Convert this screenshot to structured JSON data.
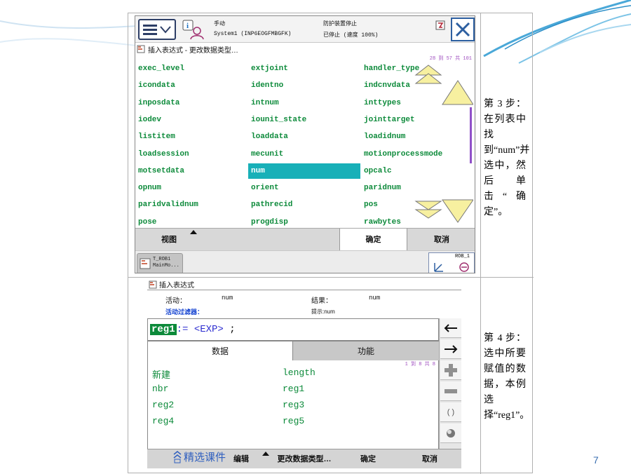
{
  "colors": {
    "list_text": "#0c8a3a",
    "selection": "#18b0b8",
    "accent_purple": "#9050c8",
    "deco_blue": "#4aa8d8"
  },
  "screen1": {
    "status": {
      "mode": "手动",
      "system": "System1 (INP6EOGFMBGFK)",
      "safety": "防护装置停止",
      "state": "已停止 (速度 100%)"
    },
    "title": "插入表达式 - 更改数据类型…",
    "counter": "28 到 57 共 101",
    "items": [
      [
        "exec_level",
        "extjoint",
        "handler_type"
      ],
      [
        "icondata",
        "identno",
        "indcnvdata"
      ],
      [
        "inposdata",
        "intnum",
        "inttypes"
      ],
      [
        "iodev",
        "iounit_state",
        "jointtarget"
      ],
      [
        "listitem",
        "loaddata",
        "loadidnum"
      ],
      [
        "loadsession",
        "mecunit",
        "motionprocessmode"
      ],
      [
        "motsetdata",
        "num",
        "opcalc"
      ],
      [
        "opnum",
        "orient",
        "paridnum"
      ],
      [
        "paridvalidnum",
        "pathrecid",
        "pos"
      ],
      [
        "pose",
        "progdisp",
        "rawbytes"
      ]
    ],
    "selected_item": "num",
    "bottom": {
      "view": "视图",
      "ok": "确定",
      "cancel": "取消"
    },
    "taskbar": {
      "task_line1": "T_ROB1",
      "task_line2": "MainMo...",
      "rob": "ROB_1"
    }
  },
  "step3": {
    "text": "第 3 步：在列表中找到“num”并选中，然后单击“确定”。"
  },
  "screen2": {
    "title": "插入表达式",
    "active_label": "活动：",
    "active_value": "num",
    "result_label": "结果：",
    "result_value": "num",
    "filter_label": "活动过滤器：",
    "hint": "提示:num",
    "expr_reg": "reg1",
    "expr_rest": ":= ",
    "expr_exp": "<EXP>",
    "expr_end": " ;",
    "tabs": {
      "data": "数据",
      "function": "功能"
    },
    "counter": "1 到 8 共 8",
    "items": [
      [
        "新建",
        "length"
      ],
      [
        "nbr",
        "reg1"
      ],
      [
        "reg2",
        "reg3"
      ],
      [
        "reg4",
        "reg5"
      ]
    ],
    "bottom": {
      "edit": "编辑",
      "change_type": "更改数据类型…",
      "ok": "确定",
      "cancel": "取消"
    },
    "side_icons": [
      "arrow-left-icon",
      "arrow-right-icon",
      "plus-icon",
      "minus-icon",
      "parentheses-icon",
      "toggle-icon"
    ]
  },
  "step4": {
    "text": "第 4 步：选中所要赋值的数据，本例选择“reg1”。"
  },
  "watermark": "精选课件",
  "page_number": "7"
}
